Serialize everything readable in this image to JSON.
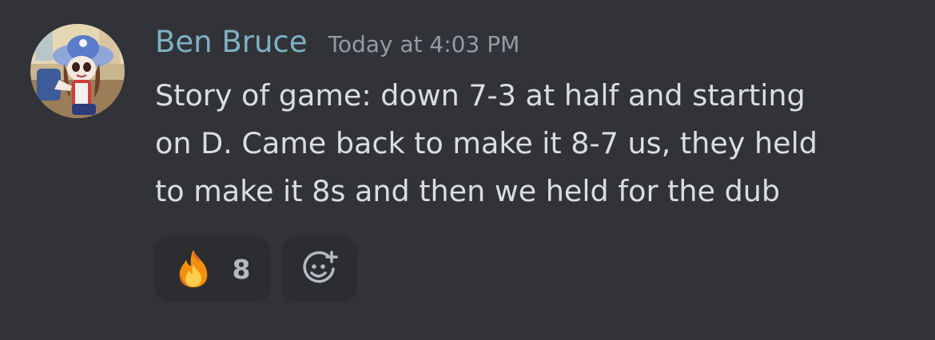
{
  "message": {
    "author": "Ben Bruce",
    "timestamp": "Today at 4:03 PM",
    "content_lines": [
      "Story of game: down 7-3 at half and starting",
      "on D. Came back to make it 8-7 us, they held",
      "to make it 8s and then we held for the dub"
    ],
    "author_color": "#7fb0c4",
    "avatar_icon": "user-avatar"
  },
  "reactions": [
    {
      "emoji": "fire-icon",
      "count": "8"
    }
  ],
  "add_reaction": {
    "icon": "smiley-plus-icon"
  },
  "colors": {
    "background": "#313338",
    "reaction_bg": "#2b2d31",
    "text": "#dbdee1",
    "muted": "#949ba4"
  }
}
